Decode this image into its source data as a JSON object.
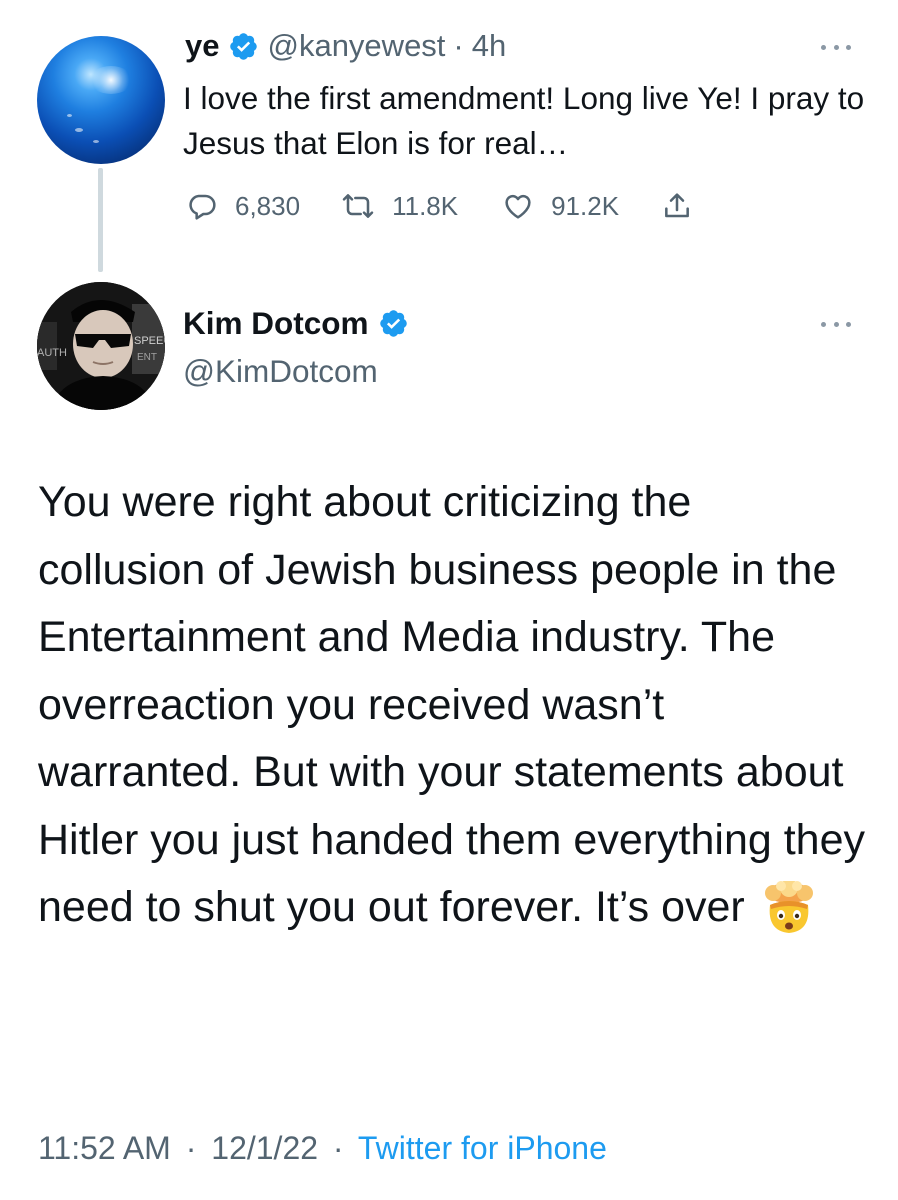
{
  "colors": {
    "text_primary": "#0f1419",
    "text_secondary": "#536471",
    "verified_blue": "#1d9bf0",
    "link_blue": "#1d9bf0",
    "thread_line": "#cfd9de"
  },
  "parent_tweet": {
    "author_name": "ye",
    "author_handle": "@kanyewest",
    "separator": "·",
    "time_ago": "4h",
    "verified": true,
    "text": "I love the first amendment! Long live Ye! I pray to Jesus that Elon is for real…",
    "avatar_icon": "blue-globe-avatar",
    "actions": {
      "replies": "6,830",
      "retweets": "11.8K",
      "likes": "91.2K"
    },
    "action_icons": [
      "reply-icon",
      "retweet-icon",
      "like-icon",
      "share-icon"
    ]
  },
  "main_tweet": {
    "author_name": "Kim Dotcom",
    "author_handle": "@KimDotcom",
    "verified": true,
    "avatar_icon": "kim-dotcom-avatar",
    "avatar_background_words": [
      "SPEEC",
      "AUTH",
      "ENT"
    ],
    "text": "You were right about criticizing the collusion of Jewish business people in the Entertainment and Media industry. The overreaction you received wasn’t warranted. But with your statements about Hitler you just handed them everything they need to shut you out forever. It’s over",
    "emoji": "exploding-head-emoji",
    "time": "11:52 AM",
    "separator": "·",
    "date": "12/1/22",
    "source": "Twitter for iPhone"
  }
}
